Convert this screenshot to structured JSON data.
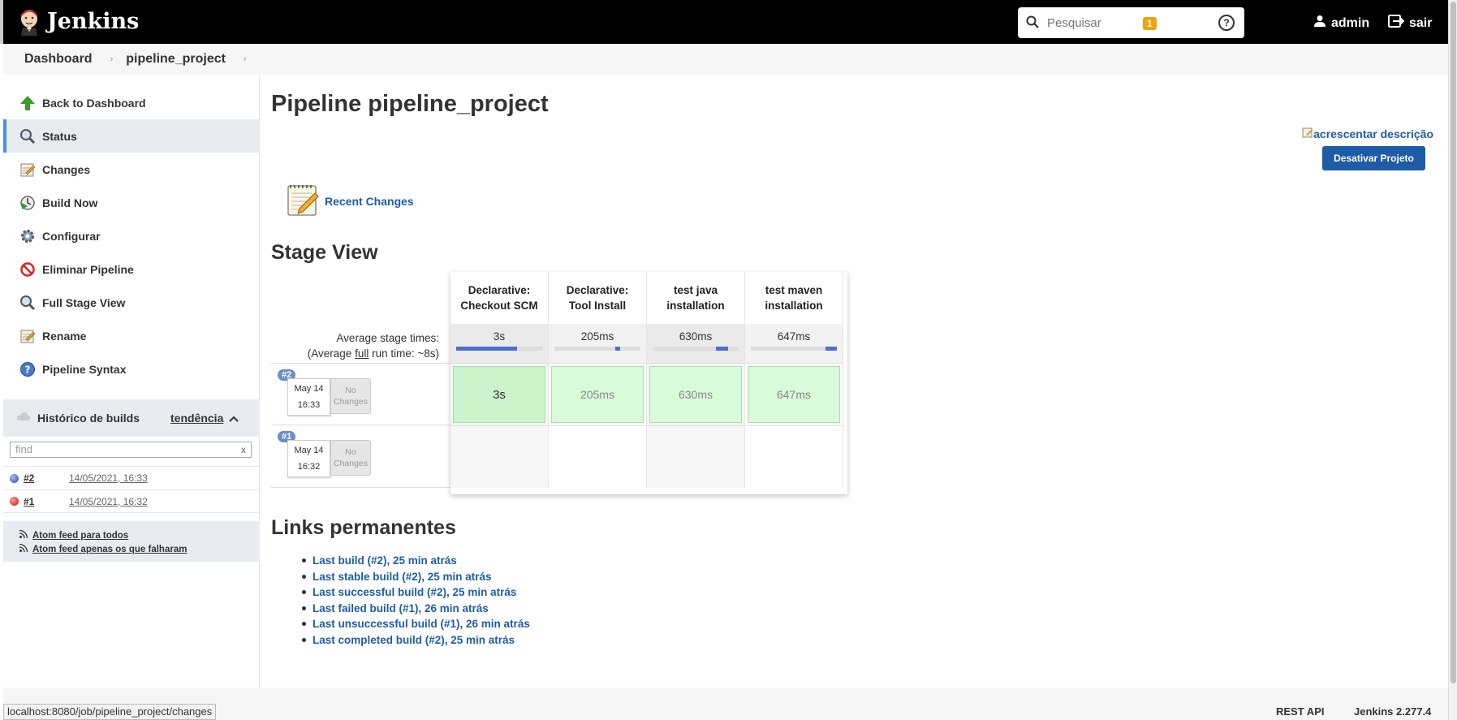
{
  "header": {
    "app_title": "Jenkins",
    "search_placeholder": "Pesquisar",
    "notification_count": "1",
    "user": "admin",
    "logout": "sair"
  },
  "breadcrumb": [
    "Dashboard",
    "pipeline_project"
  ],
  "sidebar": {
    "items": [
      {
        "label": "Back to Dashboard",
        "icon": "up-arrow-icon"
      },
      {
        "label": "Status",
        "icon": "magnifier-icon"
      },
      {
        "label": "Changes",
        "icon": "notepad-icon"
      },
      {
        "label": "Build Now",
        "icon": "clock-play-icon"
      },
      {
        "label": "Configurar",
        "icon": "gear-icon"
      },
      {
        "label": "Eliminar Pipeline",
        "icon": "no-entry-icon"
      },
      {
        "label": "Full Stage View",
        "icon": "magnifier-icon"
      },
      {
        "label": "Rename",
        "icon": "notepad-icon"
      },
      {
        "label": "Pipeline Syntax",
        "icon": "help-icon"
      }
    ],
    "build_history": {
      "title": "Histórico de builds",
      "trend": "tendência",
      "find_placeholder": "find",
      "clear": "x",
      "builds": [
        {
          "number": "#2",
          "date": "14/05/2021, 16:33",
          "status_color": "#3d6bd0"
        },
        {
          "number": "#1",
          "date": "14/05/2021, 16:32",
          "status_color": "#e02020"
        }
      ],
      "feeds": [
        "Atom feed para todos",
        "Atom feed apenas os que falharam"
      ]
    }
  },
  "main": {
    "title": "Pipeline pipeline_project",
    "add_description": "acrescentar descrição",
    "disable_button": "Desativar Projeto",
    "recent_changes": "Recent Changes",
    "stage_view": {
      "title": "Stage View",
      "avg_label": "Average stage times:",
      "avg_full_prefix": "(Average ",
      "avg_full_word": "full",
      "avg_full_suffix": " run time: ~8s)",
      "stages": [
        {
          "name_line1": "Declarative:",
          "name_line2": "Checkout SCM",
          "avg": "3s",
          "bar_start": 0.0,
          "bar_end": 0.71
        },
        {
          "name_line1": "Declarative:",
          "name_line2": "Tool Install",
          "avg": "205ms",
          "bar_start": 0.71,
          "bar_end": 0.76
        },
        {
          "name_line1": "test java",
          "name_line2": "installation",
          "avg": "630ms",
          "bar_start": 0.74,
          "bar_end": 0.88
        },
        {
          "name_line1": "test maven",
          "name_line2": "installation",
          "avg": "647ms",
          "bar_start": 0.87,
          "bar_end": 1.0
        }
      ],
      "runs": [
        {
          "tag": "#2",
          "date": "May 14",
          "time": "16:33",
          "no_changes_l1": "No",
          "no_changes_l2": "Changes",
          "durations": [
            "3s",
            "205ms",
            "630ms",
            "647ms"
          ]
        },
        {
          "tag": "#1",
          "date": "May 14",
          "time": "16:32",
          "no_changes_l1": "No",
          "no_changes_l2": "Changes",
          "durations": [
            "",
            "",
            "",
            ""
          ]
        }
      ]
    },
    "permalinks": {
      "title": "Links permanentes",
      "items": [
        "Last build (#2), 25 min atrás",
        "Last stable build (#2), 25 min atrás",
        "Last successful build (#2), 25 min atrás",
        "Last failed build (#1), 26 min atrás",
        "Last unsuccessful build (#1), 26 min atrás",
        "Last completed build (#2), 25 min atrás"
      ]
    }
  },
  "footer": {
    "status_url": "localhost:8080/job/pipeline_project/changes",
    "rest_api": "REST API",
    "version": "Jenkins 2.277.4"
  },
  "colors": {
    "header_bg": "#000000",
    "link": "#1f5ca8",
    "success_cell": "#d9fbd9",
    "badge": "#f0a30a"
  }
}
